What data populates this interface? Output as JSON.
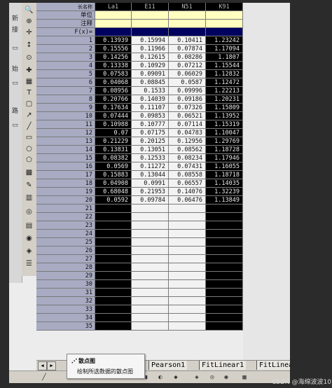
{
  "columns": [
    {
      "short_name": "La1",
      "style": "dark"
    },
    {
      "short_name": "E11",
      "style": "light"
    },
    {
      "short_name": "N51",
      "style": "light"
    },
    {
      "short_name": "K91",
      "style": "dark"
    }
  ],
  "meta_labels": {
    "name": "长名称",
    "units": "单位",
    "comment": "注释",
    "fx": "F(x)="
  },
  "rows": [
    {
      "n": "1",
      "v": [
        "0.13939",
        "0.15994",
        "0.10411",
        "1.23242"
      ]
    },
    {
      "n": "2",
      "v": [
        "0.15556",
        "0.11966",
        "0.07874",
        "1.17094"
      ]
    },
    {
      "n": "3",
      "v": [
        "0.14256",
        "0.12615",
        "0.08286",
        "1.1807"
      ]
    },
    {
      "n": "4",
      "v": [
        "0.13338",
        "0.10929",
        "0.07212",
        "1.15544"
      ]
    },
    {
      "n": "5",
      "v": [
        "0.07583",
        "0.09091",
        "0.06029",
        "1.12832"
      ]
    },
    {
      "n": "6",
      "v": [
        "0.04068",
        "0.08845",
        "0.0587",
        "1.12472"
      ]
    },
    {
      "n": "7",
      "v": [
        "0.08956",
        "0.1533",
        "0.09996",
        "1.22213"
      ]
    },
    {
      "n": "8",
      "v": [
        "0.20766",
        "0.14039",
        "0.09186",
        "1.20231"
      ]
    },
    {
      "n": "9",
      "v": [
        "0.17634",
        "0.11107",
        "0.07326",
        "1.15809"
      ]
    },
    {
      "n": "10",
      "v": [
        "0.07444",
        "0.09853",
        "0.06521",
        "1.13952"
      ]
    },
    {
      "n": "11",
      "v": [
        "0.10988",
        "0.10777",
        "0.07114",
        "1.15319"
      ]
    },
    {
      "n": "12",
      "v": [
        "0.07",
        "0.07175",
        "0.04783",
        "1.10047"
      ]
    },
    {
      "n": "13",
      "v": [
        "0.21229",
        "0.20125",
        "0.12956",
        "1.29769"
      ]
    },
    {
      "n": "14",
      "v": [
        "0.13831",
        "0.13051",
        "0.08562",
        "1.18728"
      ]
    },
    {
      "n": "15",
      "v": [
        "0.08382",
        "0.12533",
        "0.08234",
        "1.17946"
      ]
    },
    {
      "n": "16",
      "v": [
        "0.0569",
        "0.11272",
        "0.07431",
        "1.16055"
      ]
    },
    {
      "n": "17",
      "v": [
        "0.15883",
        "0.13044",
        "0.08558",
        "1.18718"
      ]
    },
    {
      "n": "18",
      "v": [
        "0.04908",
        "0.0991",
        "0.06557",
        "1.14035"
      ]
    },
    {
      "n": "19",
      "v": [
        "0.68048",
        "0.21953",
        "0.14076",
        "1.32239"
      ]
    },
    {
      "n": "20",
      "v": [
        "0.0592",
        "0.09784",
        "0.06476",
        "1.13849"
      ]
    },
    {
      "n": "21",
      "v": [
        "",
        "",
        "",
        ""
      ]
    },
    {
      "n": "22",
      "v": [
        "",
        "",
        "",
        ""
      ]
    },
    {
      "n": "23",
      "v": [
        "",
        "",
        "",
        ""
      ]
    },
    {
      "n": "24",
      "v": [
        "",
        "",
        "",
        ""
      ]
    },
    {
      "n": "25",
      "v": [
        "",
        "",
        "",
        ""
      ]
    },
    {
      "n": "26",
      "v": [
        "",
        "",
        "",
        ""
      ]
    },
    {
      "n": "27",
      "v": [
        "",
        "",
        "",
        ""
      ]
    },
    {
      "n": "28",
      "v": [
        "",
        "",
        "",
        ""
      ]
    },
    {
      "n": "29",
      "v": [
        "",
        "",
        "",
        ""
      ]
    },
    {
      "n": "30",
      "v": [
        "",
        "",
        "",
        ""
      ]
    },
    {
      "n": "31",
      "v": [
        "",
        "",
        "",
        ""
      ]
    },
    {
      "n": "32",
      "v": [
        "",
        "",
        "",
        ""
      ]
    },
    {
      "n": "33",
      "v": [
        "",
        "",
        "",
        ""
      ]
    },
    {
      "n": "34",
      "v": [
        "",
        "",
        "",
        ""
      ]
    },
    {
      "n": "35",
      "v": [
        "",
        "",
        "",
        ""
      ]
    }
  ],
  "sheet_tabs": [
    "Pearson1",
    "FitLinear1",
    "FitLinea"
  ],
  "tooltip": {
    "title": "散点图",
    "description": "绘制所选数据的散点图"
  },
  "left_labels": [
    "新",
    "接",
    "始",
    "路"
  ],
  "watermark": "CSDN @海绵波波107",
  "colors": {
    "dark_cell": "#000000",
    "light_cell": "#f2f2f2",
    "units_row": "#ffffc0",
    "fx_row": "#00005e",
    "row_header": "#a8abc2"
  }
}
